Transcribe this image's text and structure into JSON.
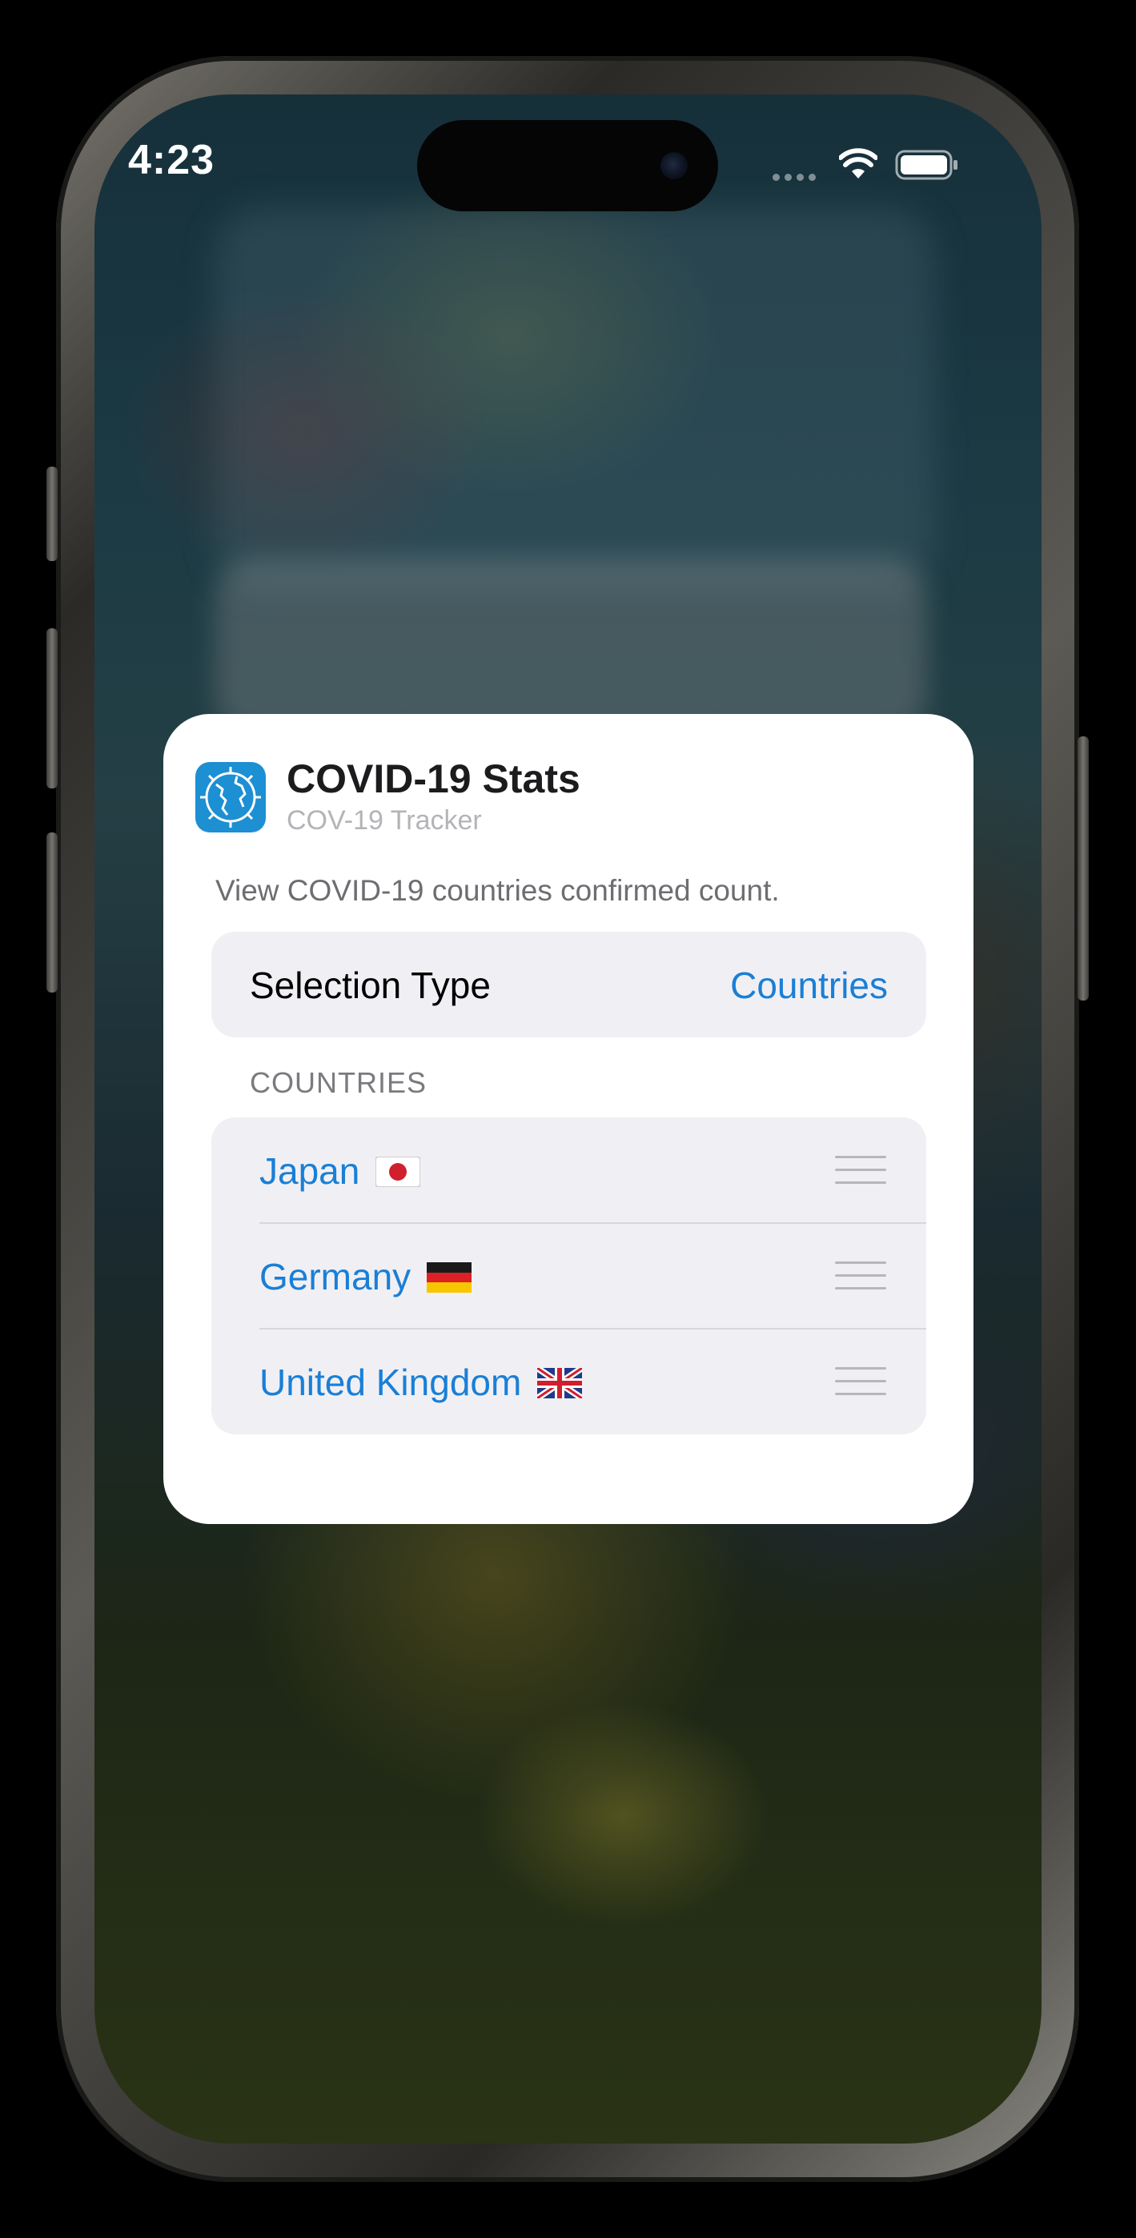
{
  "status_bar": {
    "time": "4:23"
  },
  "sheet": {
    "app_name": "COVID-19 Stats",
    "app_subtitle": "COV-19 Tracker",
    "description": "View COVID-19 countries confirmed count.",
    "selection": {
      "label": "Selection Type",
      "value": "Countries"
    },
    "countries_header": "COUNTRIES",
    "countries": [
      {
        "name": "Japan",
        "flag": "japan-flag-icon"
      },
      {
        "name": "Germany",
        "flag": "germany-flag-icon"
      },
      {
        "name": "United Kingdom",
        "flag": "uk-flag-icon"
      }
    ]
  },
  "colors": {
    "accent": "#1a7fd6",
    "app_icon": "#1d8fd3",
    "row_background": "#f0f0f4"
  }
}
